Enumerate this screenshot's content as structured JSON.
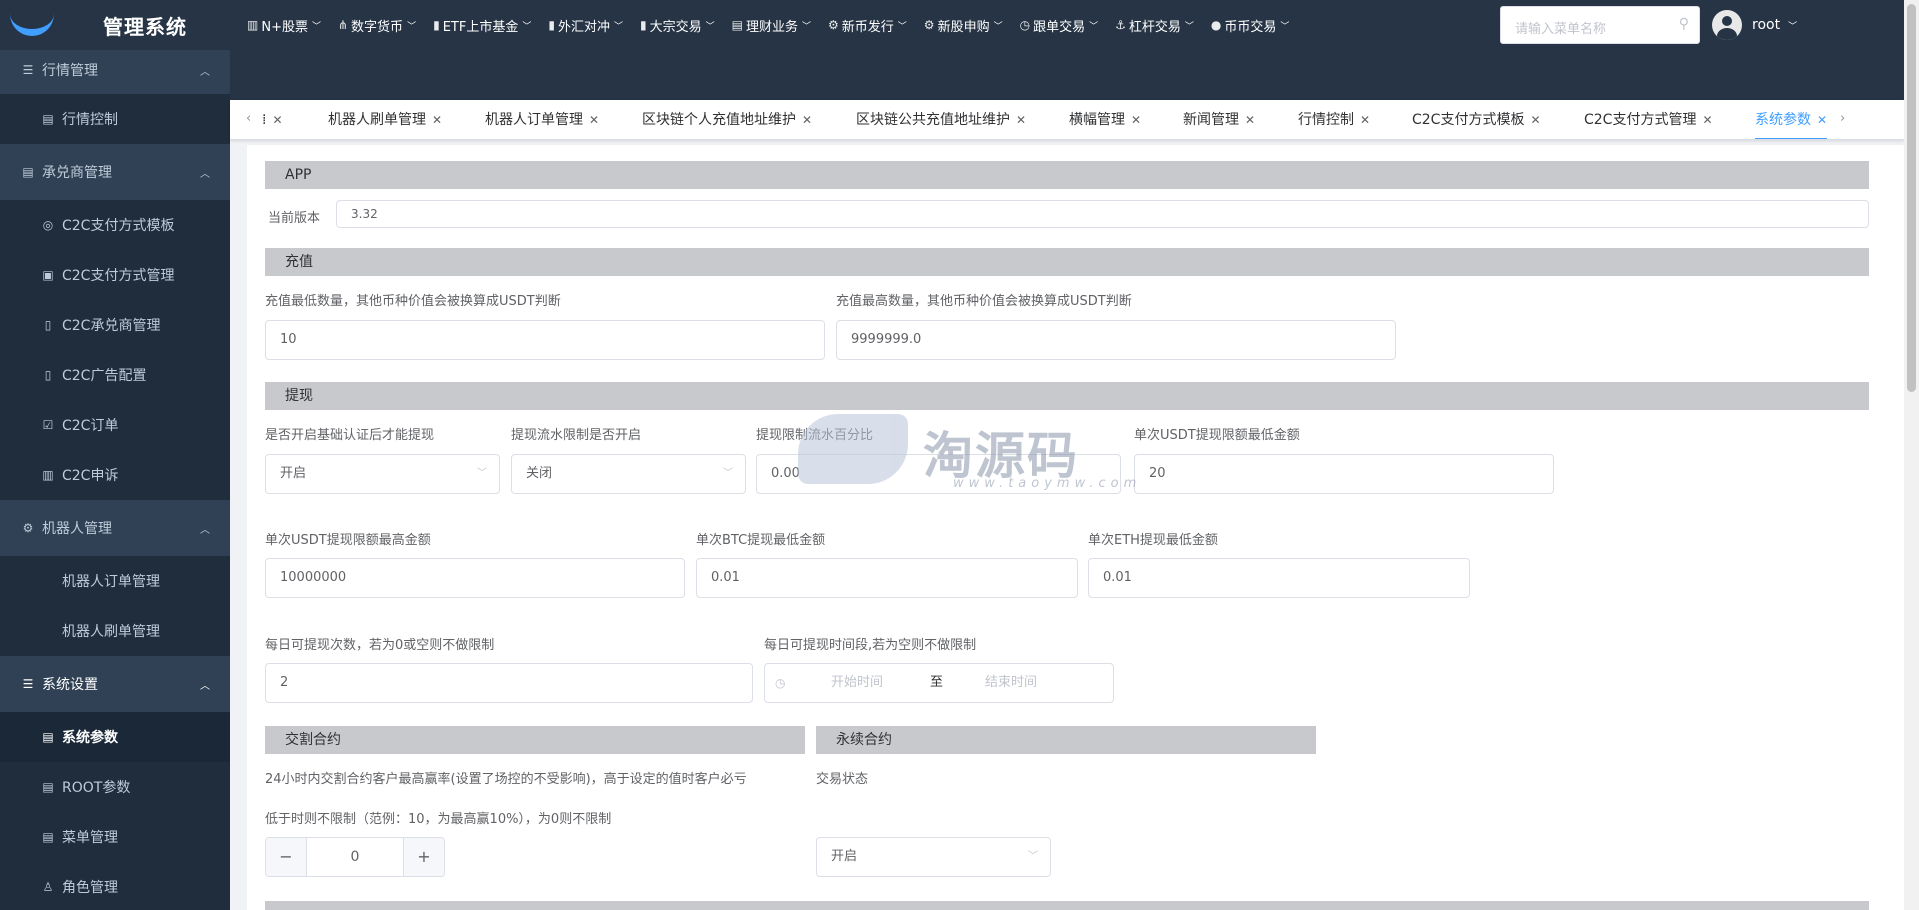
{
  "app": {
    "title": "管理系统"
  },
  "topnav": [
    {
      "label": "N+股票",
      "icon": "chart-icon"
    },
    {
      "label": "数字货币",
      "icon": "share-icon"
    },
    {
      "label": "ETF上市基金",
      "icon": "bars-icon"
    },
    {
      "label": "外汇对冲",
      "icon": "bars-icon"
    },
    {
      "label": "大宗交易",
      "icon": "bars-icon"
    },
    {
      "label": "理财业务",
      "icon": "list-icon"
    },
    {
      "label": "新币发行",
      "icon": "gear-icon"
    },
    {
      "label": "新股申购",
      "icon": "gear-icon"
    },
    {
      "label": "跟单交易",
      "icon": "clock-icon"
    },
    {
      "label": "杠杆交易",
      "icon": "anchor-icon"
    },
    {
      "label": "币币交易",
      "icon": "pin-icon"
    }
  ],
  "search": {
    "placeholder": "请输入菜单名称"
  },
  "user": {
    "name": "root"
  },
  "sidebar": {
    "market_group": "行情管理",
    "market_control": "行情控制",
    "acceptor_group": "承兑商管理",
    "c2c_pay_template": "C2C支付方式模板",
    "c2c_pay_manage": "C2C支付方式管理",
    "c2c_acceptor": "C2C承兑商管理",
    "c2c_ad": "C2C广告配置",
    "c2c_order": "C2C订单",
    "c2c_appeal": "C2C申诉",
    "robot_group": "机器人管理",
    "robot_order": "机器人订单管理",
    "robot_brush": "机器人刷单管理",
    "system_group": "系统设置",
    "system_params": "系统参数",
    "root_params": "ROOT参数",
    "menu_manage": "菜单管理",
    "role_manage": "角色管理"
  },
  "tags": [
    {
      "label": "机器人刷单管理"
    },
    {
      "label": "机器人订单管理"
    },
    {
      "label": "区块链个人充值地址维护"
    },
    {
      "label": "区块链公共充值地址维护"
    },
    {
      "label": "横幅管理"
    },
    {
      "label": "新闻管理"
    },
    {
      "label": "行情控制"
    },
    {
      "label": "C2C支付方式模板"
    },
    {
      "label": "C2C支付方式管理"
    },
    {
      "label": "系统参数"
    }
  ],
  "form": {
    "app": {
      "title": "APP",
      "version_label": "当前版本",
      "version_value": "3.32"
    },
    "recharge": {
      "title": "充值",
      "min_label": "充值最低数量，其他币种价值会被换算成USDT判断",
      "min_value": "10",
      "max_label": "充值最高数量，其他币种价值会被换算成USDT判断",
      "max_value": "9999999.0"
    },
    "withdraw": {
      "title": "提现",
      "kyc_label": "是否开启基础认证后才能提现",
      "kyc_value": "开启",
      "flow_limit_label": "提现流水限制是否开启",
      "flow_limit_value": "关闭",
      "flow_percent_label": "提现限制流水百分比",
      "flow_percent_value": "0.00",
      "usdt_min_label": "单次USDT提现限额最低金额",
      "usdt_min_value": "20",
      "usdt_max_label": "单次USDT提现限额最高金额",
      "usdt_max_value": "10000000",
      "btc_min_label": "单次BTC提现最低金额",
      "btc_min_value": "0.01",
      "eth_min_label": "单次ETH提现最低金额",
      "eth_min_value": "0.01",
      "daily_count_label": "每日可提现次数，若为0或空则不做限制",
      "daily_count_value": "2",
      "daily_time_label": "每日可提现时间段,若为空则不做限制",
      "time_start_placeholder": "开始时间",
      "time_sep": "至",
      "time_end_placeholder": "结束时间"
    },
    "delivery": {
      "title": "交割合约",
      "desc_line1": "24小时内交割合约客户最高赢率(设置了场控的不受影响)，高于设定的值时客户必亏",
      "desc_line2": "低于时则不限制（范例：10，为最高赢10%），为0则不限制",
      "rate_value": "0",
      "minus": "−",
      "plus": "+"
    },
    "perpetual": {
      "title": "永续合约",
      "status_label": "交易状态",
      "status_value": "开启"
    }
  },
  "watermark": {
    "text": "淘源码",
    "sub": "www.taoymw.com"
  }
}
